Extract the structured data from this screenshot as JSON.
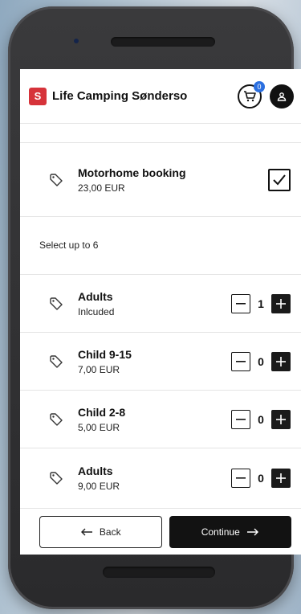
{
  "header": {
    "logo_icon": "camping-logo-icon",
    "logo_text": "S",
    "title": "Life Camping Sønderso",
    "cart_count": "0",
    "cart_icon": "shopping-cart-icon",
    "user_icon": "user-icon"
  },
  "main_item": {
    "icon": "tag-icon",
    "title": "Motorhome booking",
    "price": "23,00 EUR",
    "checked": true
  },
  "select_label": "Select up to 6",
  "options": [
    {
      "title": "Adults",
      "price": "Inlcuded",
      "qty": "1"
    },
    {
      "title": "Child 9-15",
      "price": "7,00 EUR",
      "qty": "0"
    },
    {
      "title": "Child 2-8",
      "price": "5,00 EUR",
      "qty": "0"
    },
    {
      "title": "Adults",
      "price": "9,00 EUR",
      "qty": "0"
    }
  ],
  "footer": {
    "back_label": "Back",
    "continue_label": "Continue"
  },
  "colors": {
    "brand_red": "#d6333a",
    "cart_badge": "#2b6fe0",
    "dark": "#121212"
  }
}
